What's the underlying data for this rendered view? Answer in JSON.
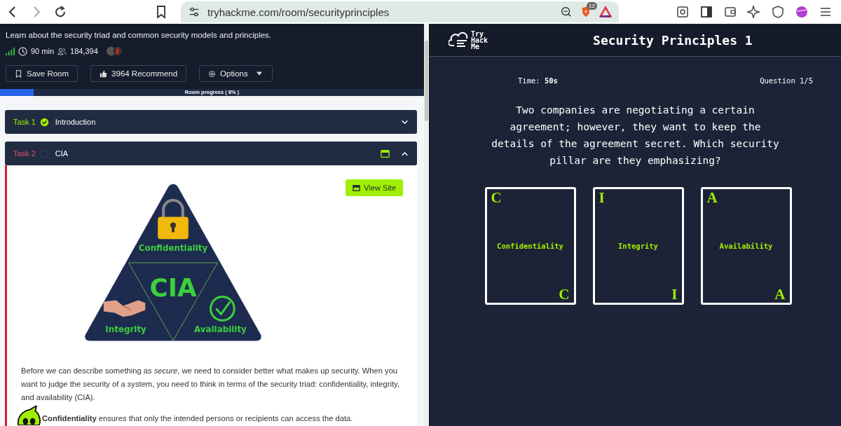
{
  "browser": {
    "url": "tryhackme.com/room/securityprinciples",
    "shields_count": "12"
  },
  "room": {
    "description": "Learn about the security triad and common security models and principles.",
    "duration": "90 min",
    "users": "184,394",
    "buttons": [
      {
        "kind": "save",
        "label": "Save Room"
      },
      {
        "kind": "recommend",
        "label": "3964 Recommend"
      },
      {
        "kind": "options",
        "label": "Options"
      }
    ],
    "progress": {
      "label": "Room progress ( 8% )",
      "level": 0.08
    }
  },
  "tasks": [
    {
      "label": "Task 1",
      "title": "Introduction",
      "completed": true,
      "expanded": false
    },
    {
      "label": "Task 2",
      "title": "CIA",
      "completed": false,
      "expanded": true
    }
  ],
  "task_content": {
    "view_site": "View Site",
    "diagram": {
      "top": "Confidentiality",
      "center": "CIA",
      "left": "Integrity",
      "right": "Availability"
    },
    "paragraph": "Before we can describe something as *secure*, we need to consider better what makes up security. When you want to judge the security of a system, you need to think in terms of the security triad: confidentiality, integrity, and availability (CIA).",
    "definition": "**Confidentiality** ensures that only the intended persons or recipients can access the data."
  },
  "quiz": {
    "logo": [
      "Try",
      "Hack",
      "Me"
    ],
    "title": "Security Principles 1",
    "time_label": "Time:",
    "time": "50s",
    "question_number": "Question 1/5",
    "question": "Two companies are negotiating a certain agreement; however, they want to keep the details of the agreement secret. Which security pillar are they emphasizing?",
    "cards": [
      {
        "letter": "C",
        "name": "Confidentiality",
        "corner_letter": "C"
      },
      {
        "letter": "I",
        "name": "Integrity",
        "corner_letter": "I"
      },
      {
        "letter": "A",
        "name": "Availability",
        "corner_letter": "A"
      }
    ]
  }
}
